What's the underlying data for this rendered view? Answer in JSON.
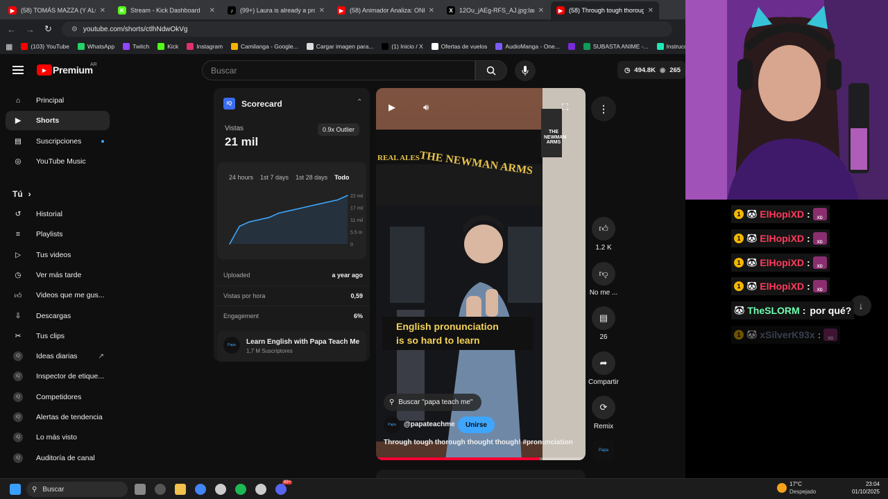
{
  "browser": {
    "tabs": [
      {
        "title": "(58) TOMÁS MAZZA (Y ALONSO",
        "color": "#ff0000",
        "glyph": "▶"
      },
      {
        "title": "Stream - Kick Dashboard",
        "color": "#53fc18",
        "glyph": "K"
      },
      {
        "title": "(99+) Laura is already a profess",
        "color": "#000000",
        "glyph": "♪"
      },
      {
        "title": "(58) Animador Analiza: ONE PIE",
        "color": "#ff0000",
        "glyph": "▶"
      },
      {
        "title": "12Ou_jAEg-RFS_AJ.jpg:large (1",
        "color": "#000000",
        "glyph": "X"
      },
      {
        "title": "(58) Through tough thorough th",
        "color": "#ff0000",
        "glyph": "▶"
      }
    ],
    "url": "youtube.com/shorts/ctlhNdwOkVg",
    "bookmarks": [
      {
        "label": "(103) YouTube",
        "color": "#ff0000"
      },
      {
        "label": "WhatsApp",
        "color": "#25d366"
      },
      {
        "label": "Twitch",
        "color": "#9146ff"
      },
      {
        "label": "Kick",
        "color": "#53fc18"
      },
      {
        "label": "Instagram",
        "color": "#e1306c"
      },
      {
        "label": "Camilanga - Google...",
        "color": "#f4b400"
      },
      {
        "label": "Cargar imagen para...",
        "color": "#dddddd"
      },
      {
        "label": "(1) Inicio / X",
        "color": "#000000"
      },
      {
        "label": "Ofertas de vuelos",
        "color": "#ffffff"
      },
      {
        "label": "AudioManga - One...",
        "color": "#7c5cff"
      },
      {
        "label": "",
        "color": "#7a2bd9"
      },
      {
        "label": "SUBASTA ANIME -...",
        "color": "#0f9d58"
      },
      {
        "label": "Instrucciones del",
        "color": "#1de9b6"
      }
    ]
  },
  "header": {
    "logo": "Premium",
    "region": "AR",
    "search_placeholder": "Buscar",
    "views_stat": "494.8K",
    "watching_stat": "265"
  },
  "sidebar": {
    "main": [
      {
        "label": "Principal",
        "icon": "home-icon"
      },
      {
        "label": "Shorts",
        "icon": "shorts-icon"
      },
      {
        "label": "Suscripciones",
        "icon": "subscriptions-icon"
      },
      {
        "label": "YouTube Music",
        "icon": "music-icon"
      }
    ],
    "you_label": "Tú",
    "you": [
      {
        "label": "Historial",
        "icon": "history-icon"
      },
      {
        "label": "Playlists",
        "icon": "playlist-icon"
      },
      {
        "label": "Tus videos",
        "icon": "video-icon"
      },
      {
        "label": "Ver más tarde",
        "icon": "clock-icon"
      },
      {
        "label": "Videos que me gus...",
        "icon": "like-icon"
      },
      {
        "label": "Descargas",
        "icon": "download-icon"
      },
      {
        "label": "Tus clips",
        "icon": "scissors-icon"
      }
    ],
    "tools": [
      {
        "label": "Ideas diarias"
      },
      {
        "label": "Inspector de etique..."
      },
      {
        "label": "Competidores"
      },
      {
        "label": "Alertas de tendencia"
      },
      {
        "label": "Lo más visto"
      },
      {
        "label": "Auditoría de canal"
      }
    ]
  },
  "scorecard": {
    "title": "Scorecard",
    "views_label": "Vistas",
    "views_value": "21 mil",
    "outlier": "0.9x Outlier",
    "ranges": [
      "24 hours",
      "1st 7 days",
      "1st 28 days",
      "Todo"
    ],
    "rows": [
      {
        "label": "Uploaded",
        "value": "a year ago"
      },
      {
        "label": "Vistas por hora",
        "value": "0,59"
      },
      {
        "label": "Engagement",
        "value": "6%"
      }
    ],
    "channel_name": "Learn English with Papa Teach Me",
    "channel_subs": "1,7 M Suscriptores"
  },
  "chart_data": {
    "type": "area",
    "x": [
      0,
      1,
      2,
      3,
      4,
      5,
      6,
      7,
      8,
      9,
      10,
      11,
      12
    ],
    "values": [
      0,
      8,
      10,
      11,
      12,
      14,
      15,
      16,
      17,
      18,
      19,
      20,
      22
    ],
    "ylim": [
      0,
      22
    ],
    "y_ticks": [
      "22 mil",
      "17 mil",
      "11 mil",
      "5.5 mil",
      "0"
    ],
    "color": "#3ea6ff"
  },
  "video": {
    "caption_line1": "English pronunciation",
    "caption_line2": "is so hard to learn",
    "sign_main": "THE NEWMAN ARMS",
    "sign_real": "REAL ALES",
    "sign_hanging": "THE NEWMAN ARMS",
    "search_chip": "Buscar \"papa teach me\"",
    "channel": "@papateachme",
    "join": "Unirse",
    "title": "Through tough thorough thought though! #pronunciation",
    "progress": 0.78
  },
  "actions": [
    {
      "label": "1.2 K",
      "icon": "thumbs-up-icon"
    },
    {
      "label": "No me ...",
      "icon": "thumbs-down-icon"
    },
    {
      "label": "26",
      "icon": "comment-icon"
    },
    {
      "label": "Compartir",
      "icon": "share-icon"
    },
    {
      "label": "Remix",
      "icon": "remix-icon"
    }
  ],
  "chat": [
    {
      "user": "ElHopiXD",
      "message": "",
      "color": "#ff3b5c"
    },
    {
      "user": "ElHopiXD",
      "message": "",
      "color": "#ff3b5c"
    },
    {
      "user": "ElHopiXD",
      "message": "",
      "color": "#ff3b5c"
    },
    {
      "user": "ElHopiXD",
      "message": "",
      "color": "#ff3b5c"
    },
    {
      "user": "TheSLORM",
      "message": "por qué?",
      "color": "#6fffb0"
    },
    {
      "user": "xSilverK93x",
      "message": "",
      "color": "#7a8aa6"
    }
  ],
  "taskbar": {
    "search": "Buscar",
    "temp": "17°C",
    "weather": "Despejado",
    "time": "23:04",
    "date": "01/10/2025",
    "badge": "99+"
  }
}
